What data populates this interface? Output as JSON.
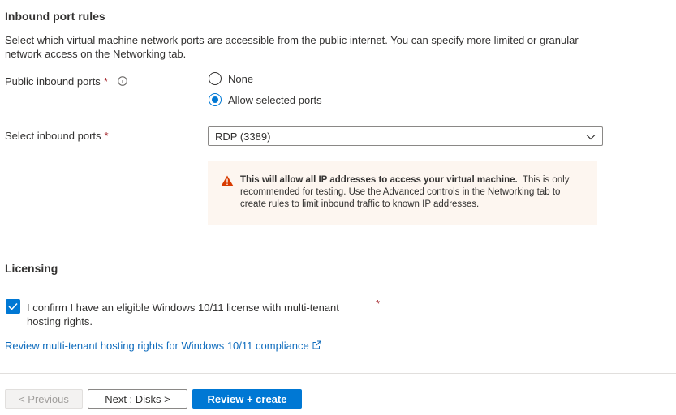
{
  "inbound": {
    "title": "Inbound port rules",
    "description": "Select which virtual machine network ports are accessible from the public internet. You can specify more limited or granular network access on the Networking tab.",
    "public_ports_label": "Public inbound ports",
    "required_mark": "*",
    "radio_options": [
      {
        "label": "None",
        "selected": false
      },
      {
        "label": "Allow selected ports",
        "selected": true
      }
    ],
    "select_ports_label": "Select inbound ports",
    "select_ports_value": "RDP (3389)",
    "warning_bold": "This will allow all IP addresses to access your virtual machine.",
    "warning_text": "This is only recommended for testing.  Use the Advanced controls in the Networking tab to create rules to limit inbound traffic to known IP addresses."
  },
  "licensing": {
    "title": "Licensing",
    "confirm_label": "I confirm I have an eligible Windows 10/11 license with multi-tenant hosting rights.",
    "confirm_checked": true,
    "required_mark": "*",
    "review_link": "Review multi-tenant hosting rights for Windows 10/11 compliance"
  },
  "footer": {
    "previous_label": "< Previous",
    "next_label": "Next : Disks >",
    "review_create_label": "Review + create"
  },
  "colors": {
    "accent": "#0078d4",
    "warning_icon": "#d83b01",
    "warning_bg": "#fdf6f0",
    "required": "#a4262c",
    "link": "#0f6cbd"
  }
}
